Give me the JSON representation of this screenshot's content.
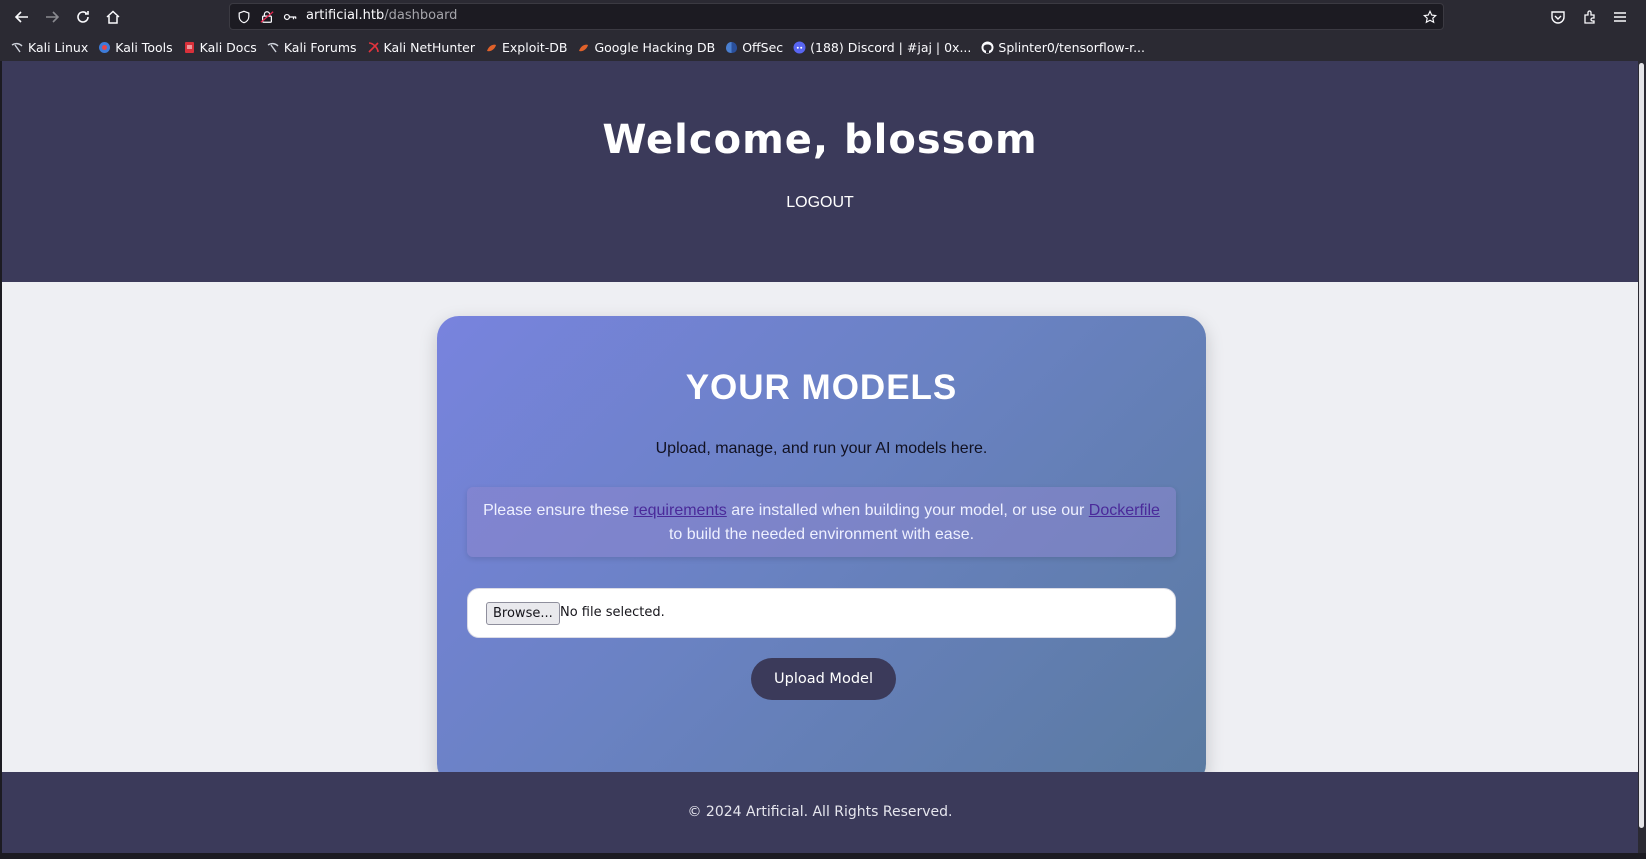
{
  "browser": {
    "url_host": "artificial.htb",
    "url_path": "/dashboard",
    "bookmarks": [
      {
        "label": "Kali Linux",
        "icon": "kali-dragon-icon"
      },
      {
        "label": "Kali Tools",
        "icon": "kali-tools-icon"
      },
      {
        "label": "Kali Docs",
        "icon": "kali-docs-icon"
      },
      {
        "label": "Kali Forums",
        "icon": "kali-dragon-icon"
      },
      {
        "label": "Kali NetHunter",
        "icon": "nethunter-icon"
      },
      {
        "label": "Exploit-DB",
        "icon": "exploit-db-icon"
      },
      {
        "label": "Google Hacking DB",
        "icon": "exploit-db-icon"
      },
      {
        "label": "OffSec",
        "icon": "offsec-icon"
      },
      {
        "label": "(188) Discord | #jaj | 0x...",
        "icon": "discord-icon"
      },
      {
        "label": "Splinter0/tensorflow-r...",
        "icon": "github-icon"
      }
    ]
  },
  "header": {
    "welcome": "Welcome, blossom",
    "logout_label": "LOGOUT"
  },
  "card": {
    "title": "YOUR MODELS",
    "subtitle": "Upload, manage, and run your AI models here.",
    "notice": {
      "prefix": "Please ensure these ",
      "link1": "requirements",
      "middle": " are installed when building your model, or use our ",
      "link2": "Dockerfile",
      "suffix": " to build the needed environment with ease."
    },
    "browse_label": "Browse...",
    "file_status": "No file selected.",
    "upload_label": "Upload Model"
  },
  "footer": {
    "text": "© 2024 Artificial. All Rights Reserved."
  },
  "colors": {
    "header_bg": "#3b3a5a",
    "page_bg": "#eeeff3",
    "link": "#4a2a9a"
  }
}
